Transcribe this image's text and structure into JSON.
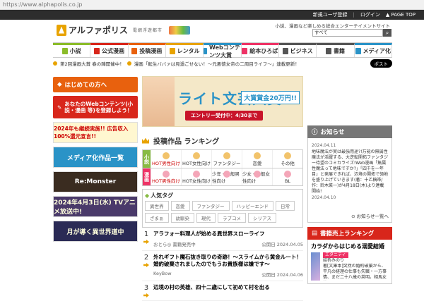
{
  "url": "https://www.alphapolis.co.jp",
  "topbar": {
    "register": "新規ユーザ登録",
    "login": "ログイン",
    "pagetop": "▲ PAGE TOP"
  },
  "header": {
    "logo": "アルファポリス",
    "logo_sub": "電網浮遊都市",
    "tagline": "小説、漫画など楽しめる総合エンターテイメントサイト",
    "search_value": "すべて"
  },
  "nav": [
    {
      "label": "小説",
      "color": "#8bbc2a"
    },
    {
      "label": "公式漫画",
      "color": "#d8261b"
    },
    {
      "label": "投稿漫画",
      "color": "#e8610e"
    },
    {
      "label": "レンタル",
      "color": "#e8a300"
    },
    {
      "label": "Webコンテンツ大賞",
      "color": "#2a93c7"
    },
    {
      "label": "絵本ひろば",
      "color": "#e36"
    },
    {
      "label": "ビジネス",
      "color": "#555"
    },
    {
      "label": "書籍",
      "color": "#555"
    },
    {
      "label": "メディア化",
      "color": "#2a93c7"
    }
  ],
  "notices": [
    "第2回漫画大賞 春の陣開催中！",
    "漫画「転生ババァは見過ごせない！〜元悪徳女帝の二周目ライフ〜」連載更新！"
  ],
  "post_button": "ポスト",
  "left": {
    "first": "はじめての方へ",
    "web": "あなたのWebコンテンツ(小説・漫画 等)を登録しよう！",
    "banners": [
      "2024年も継続実施!! 広告収入100%還元宣言!!",
      "メディア化作品一覧",
      "Re:Monster",
      "2024年4月3日(水) TVアニメ放送中!",
      "月が導く異世界道中"
    ]
  },
  "top_banner": {
    "title": "ライト文芸大賞",
    "prize": "大賞賞金20万円!!",
    "entry": "エントリー受付中：4/30まで"
  },
  "ranking": {
    "title": "投稿作品 ランキング",
    "row1_label": "小説",
    "row2_label": "漫画",
    "row1": [
      "HOT男性向け",
      "HOT女性向け",
      "ファンタジー",
      "恋愛",
      "その他"
    ],
    "row2": [
      "HOT男性向け",
      "HOT女性向け",
      "少年・一般男性向け",
      "少女・一般女性向け",
      "BL"
    ],
    "tags_title": "人気タグ",
    "tags": [
      [
        "異世界",
        "恋愛",
        "ファンタジー",
        "ハッピーエンド",
        "日常"
      ],
      [
        "ざまぁ",
        "幼馴染",
        "現代",
        "ラブコメ",
        "シリアス"
      ]
    ],
    "items": [
      {
        "num": "1",
        "title": "アラフォー料理人が始める異世界スローライフ",
        "author": "おとら◎ 書籍発売中",
        "date": "公開日 2024.04.05"
      },
      {
        "num": "2",
        "title": "外れギフト魔石抜き取りの奇跡！～スライムから黄金ルート！婚約破棄されましたのでもうお貴族様は嫌です～",
        "author": "KeyBow",
        "date": "公開日 2024.04.06"
      },
      {
        "num": "3",
        "title": "辺境の村の英雄、四十二歳にして初めて村を出る",
        "author": "",
        "date": ""
      }
    ]
  },
  "news": {
    "title": "お知らせ",
    "items": [
      {
        "date": "2024.04.11",
        "text": "地味魔法が実は最強用途?!万能の無属性魔法が活躍する、大逆転開拓ファンタジー待望のコミカライズ!Web漫画「無属性魔法って地味ですか?」「四千を一年目」と発展できれば、辺境の開拓で領地を盛り上げていきます(著：十乙稿帯/作：鈴木菜一)が4月18日(木)より連載開始!"
      },
      {
        "date": "2024.04.10",
        "text": ""
      }
    ],
    "more": "お知らせ一覧へ"
  },
  "sales": {
    "title": "書籍売上ランキング",
    "book": "カラダからはじめる溺愛結婚",
    "badge": "エタニティ",
    "author": "結祈みのり",
    "desc": "著[文庫本]突然の婚約破棄から、平凡の経理の仕事も失職・一方事情、まだ二十八歳の英明。相馬女性に…"
  }
}
